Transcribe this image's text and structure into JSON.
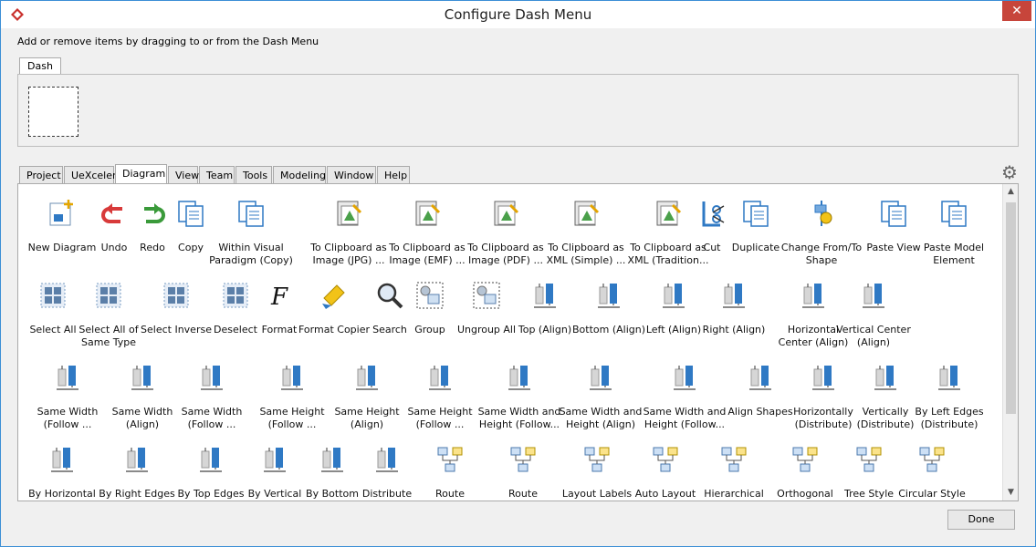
{
  "window": {
    "title": "Configure Dash Menu",
    "close_label": "✕"
  },
  "hint": "Add or remove items by dragging to or from the Dash Menu",
  "dash_tab": "Dash",
  "tabs": [
    {
      "label": "Project"
    },
    {
      "label": "UeXceler"
    },
    {
      "label": "Diagram",
      "active": true
    },
    {
      "label": "View"
    },
    {
      "label": "Team"
    },
    {
      "label": "Tools"
    },
    {
      "label": "Modeling"
    },
    {
      "label": "Window"
    },
    {
      "label": "Help"
    }
  ],
  "gear_label": "⚙",
  "done_label": "Done",
  "colors": {
    "accent": "#3c8fd6",
    "close": "#c7453b",
    "icon_blue": "#2f79c4",
    "undo_red": "#d83a3a",
    "redo_green": "#3a9a3a"
  },
  "rows": [
    [
      {
        "icon": "new-diagram-icon",
        "label": "New Diagram"
      },
      {
        "icon": "undo-icon",
        "label": "Undo"
      },
      {
        "icon": "redo-icon",
        "label": "Redo"
      },
      {
        "icon": "copy-icon",
        "label": "Copy"
      },
      {
        "icon": "copy-within-vp-icon",
        "label": "Within Visual\nParadigm (Copy)"
      },
      {
        "icon": "clipboard-jpg-icon",
        "label": "To Clipboard as\nImage (JPG) ..."
      },
      {
        "icon": "clipboard-emf-icon",
        "label": "To Clipboard as\nImage (EMF) ..."
      },
      {
        "icon": "clipboard-pdf-icon",
        "label": "To Clipboard as\nImage (PDF) ..."
      },
      {
        "icon": "clipboard-xml-simple-icon",
        "label": "To Clipboard as\nXML (Simple) ..."
      },
      {
        "icon": "clipboard-xml-traditional-icon",
        "label": "To Clipboard as\nXML (Tradition..."
      },
      {
        "icon": "cut-icon",
        "label": "Cut"
      },
      {
        "icon": "duplicate-icon",
        "label": "Duplicate"
      },
      {
        "icon": "change-shape-icon",
        "label": "Change From/To\nShape"
      },
      {
        "icon": "paste-view-icon",
        "label": "Paste View"
      },
      {
        "icon": "paste-model-element-icon",
        "label": "Paste Model\nElement"
      }
    ],
    [
      {
        "icon": "select-all-icon",
        "label": "Select All"
      },
      {
        "icon": "select-same-type-icon",
        "label": "Select All of\nSame Type"
      },
      {
        "icon": "select-inverse-icon",
        "label": "Select Inverse"
      },
      {
        "icon": "deselect-icon",
        "label": "Deselect"
      },
      {
        "icon": "format-icon",
        "label": "Format"
      },
      {
        "icon": "format-copier-icon",
        "label": "Format Copier"
      },
      {
        "icon": "search-icon",
        "label": "Search"
      },
      {
        "icon": "group-icon",
        "label": "Group"
      },
      {
        "icon": "ungroup-icon",
        "label": "Ungroup All"
      },
      {
        "icon": "align-top-icon",
        "label": "Top (Align)"
      },
      {
        "icon": "align-bottom-icon",
        "label": "Bottom (Align)"
      },
      {
        "icon": "align-left-icon",
        "label": "Left (Align)"
      },
      {
        "icon": "align-right-icon",
        "label": "Right (Align)"
      },
      {
        "icon": "align-horizontal-center-icon",
        "label": "Horizontal\nCenter (Align)"
      },
      {
        "icon": "align-vertical-center-icon",
        "label": "Vertical Center\n(Align)"
      }
    ],
    [
      {
        "icon": "same-width-follow-icon",
        "label": "Same Width\n(Follow ..."
      },
      {
        "icon": "same-width-align-icon",
        "label": "Same Width\n(Align)"
      },
      {
        "icon": "same-width-follow-2-icon",
        "label": "Same Width\n(Follow ..."
      },
      {
        "icon": "same-height-follow-icon",
        "label": "Same Height\n(Follow ..."
      },
      {
        "icon": "same-height-align-icon",
        "label": "Same Height\n(Align)"
      },
      {
        "icon": "same-height-follow-2-icon",
        "label": "Same Height\n(Follow ..."
      },
      {
        "icon": "same-size-follow-icon",
        "label": "Same Width and\nHeight (Follow..."
      },
      {
        "icon": "same-size-align-icon",
        "label": "Same Width and\nHeight (Align)"
      },
      {
        "icon": "same-size-follow-2-icon",
        "label": "Same Width and\nHeight (Follow..."
      },
      {
        "icon": "align-shapes-icon",
        "label": "Align Shapes"
      },
      {
        "icon": "distribute-horizontally-icon",
        "label": "Horizontally\n(Distribute)"
      },
      {
        "icon": "distribute-vertically-icon",
        "label": "Vertically\n(Distribute)"
      },
      {
        "icon": "distribute-left-edges-icon",
        "label": "By Left Edges\n(Distribute)"
      }
    ],
    [
      {
        "icon": "distribute-horizontal-center-icon",
        "label": "By Horizontal\nCe..."
      },
      {
        "icon": "distribute-right-edges-icon",
        "label": "By Right Edges\n(Di..."
      },
      {
        "icon": "distribute-top-edges-icon",
        "label": "By Top Edges\n(Di..."
      },
      {
        "icon": "distribute-vertical-center-icon",
        "label": "By Vertical\nCe..."
      },
      {
        "icon": "distribute-bottom-edges-icon",
        "label": "By Bottom\nEd..."
      },
      {
        "icon": "distribute-spacing-icon",
        "label": "Distribute\nSp..."
      },
      {
        "icon": "route-icon",
        "label": "Route\n..."
      },
      {
        "icon": "route-2-icon",
        "label": "Route\n..."
      },
      {
        "icon": "layout-labels-icon",
        "label": "Layout Labels\n(..."
      },
      {
        "icon": "auto-layout-icon",
        "label": "Auto Layout\n(..."
      },
      {
        "icon": "hierarchical-layout-icon",
        "label": "Hierarchical\nSt..."
      },
      {
        "icon": "orthogonal-layout-icon",
        "label": "Orthogonal\nSt..."
      },
      {
        "icon": "tree-style-icon",
        "label": "Tree Style\n(..."
      },
      {
        "icon": "circular-style-icon",
        "label": "Circular Style\n(..."
      }
    ]
  ]
}
